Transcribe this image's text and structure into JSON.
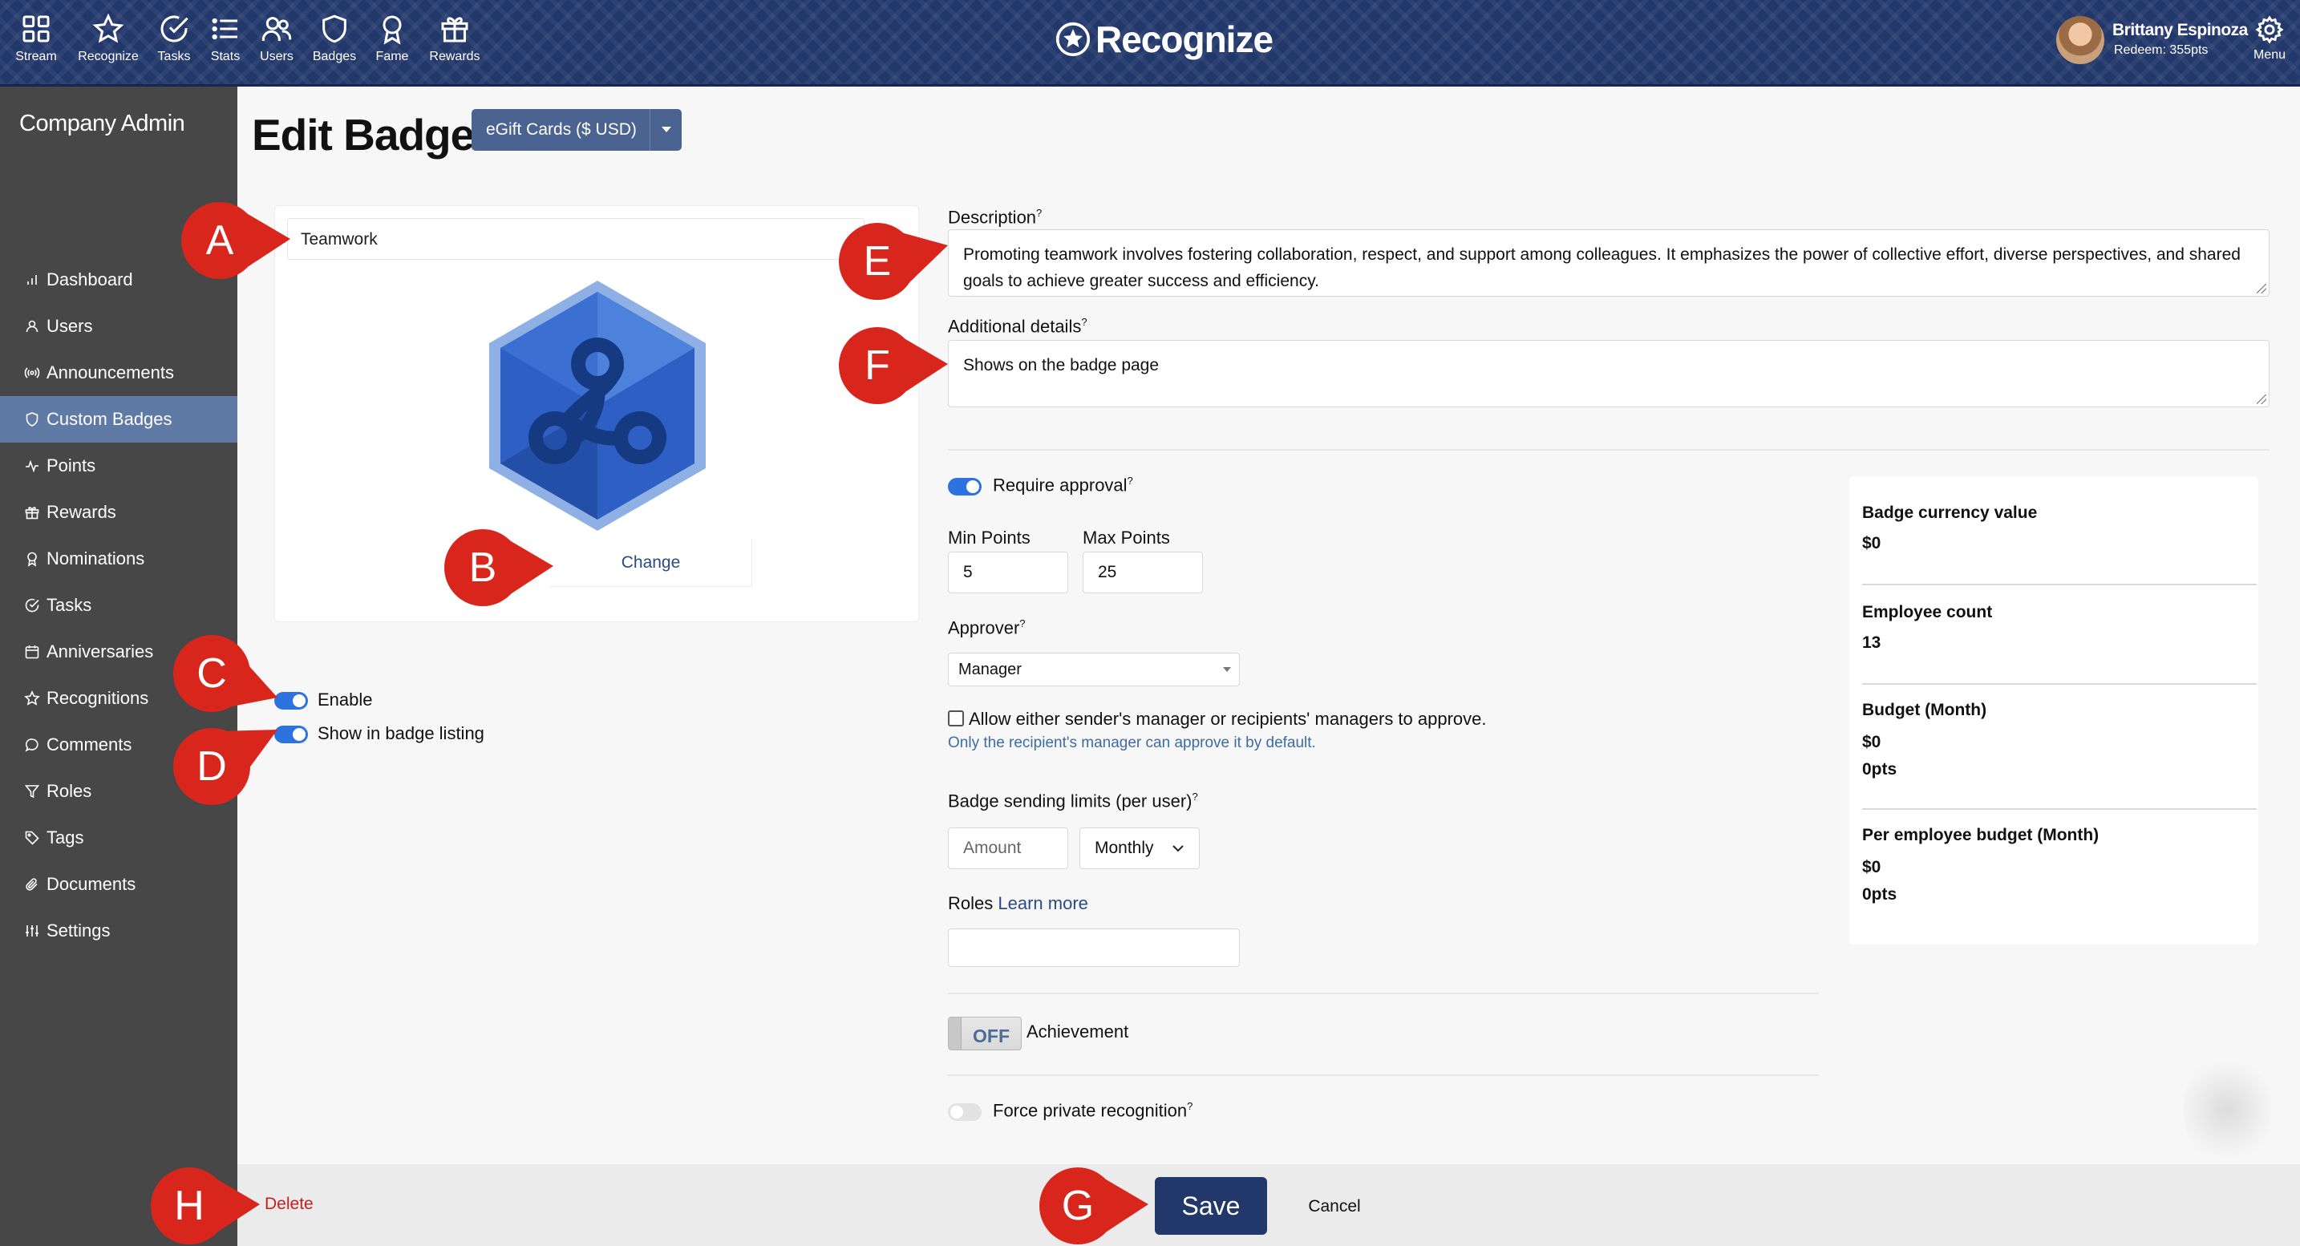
{
  "nav": {
    "items": [
      {
        "label": "Stream",
        "icon": "grid-icon"
      },
      {
        "label": "Recognize",
        "icon": "star-icon"
      },
      {
        "label": "Tasks",
        "icon": "check-circle-icon"
      },
      {
        "label": "Stats",
        "icon": "list-icon"
      },
      {
        "label": "Users",
        "icon": "users-icon"
      },
      {
        "label": "Badges",
        "icon": "shield-icon"
      },
      {
        "label": "Fame",
        "icon": "award-icon"
      },
      {
        "label": "Rewards",
        "icon": "gift-icon"
      }
    ],
    "brand": "Recognize",
    "user_name": "Brittany Espinoza",
    "user_points": "Redeem: 355pts",
    "menu_label": "Menu"
  },
  "sidebar": {
    "title": "Company Admin",
    "items": [
      {
        "label": "Dashboard",
        "icon": "bar-chart-icon"
      },
      {
        "label": "Users",
        "icon": "user-icon"
      },
      {
        "label": "Announcements",
        "icon": "broadcast-icon"
      },
      {
        "label": "Custom Badges",
        "icon": "shield-icon"
      },
      {
        "label": "Points",
        "icon": "pulse-icon"
      },
      {
        "label": "Rewards",
        "icon": "gift-icon"
      },
      {
        "label": "Nominations",
        "icon": "award-icon"
      },
      {
        "label": "Tasks",
        "icon": "check-circle-icon"
      },
      {
        "label": "Anniversaries",
        "icon": "calendar-icon"
      },
      {
        "label": "Recognitions",
        "icon": "star-icon"
      },
      {
        "label": "Comments",
        "icon": "comment-icon"
      },
      {
        "label": "Roles",
        "icon": "filter-icon"
      },
      {
        "label": "Tags",
        "icon": "tag-icon"
      },
      {
        "label": "Documents",
        "icon": "paperclip-icon"
      },
      {
        "label": "Settings",
        "icon": "sliders-icon"
      }
    ],
    "active_item": "Custom Badges"
  },
  "page": {
    "title": "Edit Badge",
    "currency_dropdown": "eGift Cards ($ USD)"
  },
  "badge": {
    "name": "Teamwork",
    "change_label": "Change",
    "enable_label": "Enable",
    "enable_on": true,
    "show_listing_label": "Show in badge listing",
    "show_listing_on": true
  },
  "form": {
    "description_label": "Description",
    "description_value": "Promoting teamwork involves fostering collaboration, respect, and support among colleagues. It emphasizes the power of collective effort, diverse perspectives, and shared goals to achieve greater success and efficiency.",
    "additional_label": "Additional details",
    "additional_value": "Shows on the badge page",
    "require_approval_label": "Require approval",
    "require_approval_on": true,
    "min_points_label": "Min Points",
    "min_points_value": "5",
    "max_points_label": "Max Points",
    "max_points_value": "25",
    "approver_label": "Approver",
    "approver_value": "Manager",
    "allow_managers_label": "Allow either sender's manager or recipients' managers to approve.",
    "allow_managers_checked": false,
    "allow_managers_hint": "Only the recipient's manager can approve it by default.",
    "sending_limits_label": "Badge sending limits (per user)",
    "amount_placeholder": "Amount",
    "period_value": "Monthly",
    "roles_label": "Roles",
    "roles_link": "Learn more",
    "roles_value": "",
    "achievement_switch": "OFF",
    "achievement_label": "Achievement",
    "force_private_label": "Force private recognition",
    "force_private_on": false,
    "help_mark": "?"
  },
  "stats": {
    "items": [
      {
        "label": "Badge currency value",
        "values": [
          "$0"
        ]
      },
      {
        "label": "Employee count",
        "values": [
          "13"
        ]
      },
      {
        "label": "Budget (Month)",
        "values": [
          "$0",
          "0pts"
        ]
      },
      {
        "label": "Per employee budget (Month)",
        "values": [
          "$0",
          "0pts"
        ]
      }
    ]
  },
  "footer": {
    "delete_label": "Delete",
    "save_label": "Save",
    "cancel_label": "Cancel"
  },
  "callouts": {
    "a": "A",
    "b": "B",
    "c": "C",
    "d": "D",
    "e": "E",
    "f": "F",
    "g": "G",
    "h": "H",
    "color": "#d9261c"
  },
  "colors": {
    "nav_bg": "#22376a",
    "sidebar_bg": "#474747",
    "sidebar_active": "#5e7aa5",
    "toggle_on": "#2c73df",
    "delete": "#c42020",
    "badge_blue": "#2d5fc4"
  }
}
